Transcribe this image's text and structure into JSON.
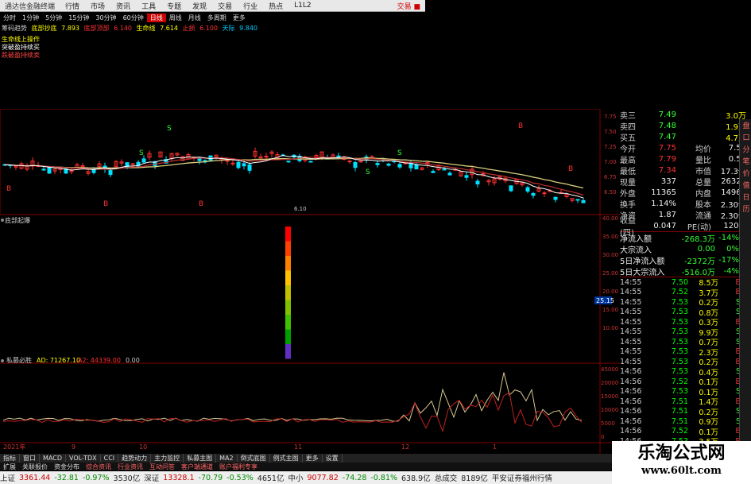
{
  "topbar": {
    "app": "通达信金融终端",
    "menus": [
      "行情",
      "市场",
      "资讯",
      "工具",
      "专题",
      "发现",
      "交易",
      "行业",
      "热点",
      "L1L2"
    ],
    "right": "交易 ■"
  },
  "periods": [
    "分时",
    "1分钟",
    "5分钟",
    "15分钟",
    "30分钟",
    "60分钟",
    "日线",
    "周线",
    "月线",
    "多周期",
    "更多"
  ],
  "indicator_line": {
    "name": "筹码趋势",
    "values": [
      {
        "label": "底部抄底",
        "value": "7.893"
      },
      {
        "label": "底部顶部",
        "value": "6.140"
      },
      {
        "label": "生命线",
        "value": "7.614"
      },
      {
        "label": "止损",
        "value": "6.100"
      },
      {
        "label": "天际",
        "value": "9.840"
      }
    ]
  },
  "signals": [
    {
      "text": "生命线上操作",
      "color": "#ffff00"
    },
    {
      "text": "突破盈持续买",
      "color": "#ffffff"
    },
    {
      "text": "跌破盈持续卖",
      "color": "#ff4040"
    }
  ],
  "main_chart": {
    "yticks": [
      "7.75",
      "7.50",
      "7.25",
      "7.00",
      "6.75",
      "6.50"
    ],
    "low_label": "6.10",
    "x_markers": [
      "11",
      "12",
      "B",
      "S",
      "B"
    ]
  },
  "panel2": {
    "title": "底部起爆",
    "yticks": [
      "40.00",
      "35.00",
      "30.00",
      "25.00",
      "20.00",
      "15.00",
      "10.00"
    ],
    "cursor_value": "25.15"
  },
  "panel3": {
    "title": "私募必胜",
    "ad_label": "AD: 71267.10",
    "a2_label": "A2: 44339.00",
    "a3_label": "0.00",
    "yticks": [
      "45000",
      "20000",
      "15000",
      "10000",
      "5000",
      "0"
    ]
  },
  "x_axis_labels": [
    "2021年",
    "9",
    "10",
    "11",
    "12",
    "1"
  ],
  "quote": {
    "rows": [
      {
        "l": "卖三",
        "p": "7.49",
        "r": "",
        "s": "3.0万"
      },
      {
        "l": "卖四",
        "p": "7.48",
        "r": "",
        "s": "1.9万"
      },
      {
        "l": "买五",
        "p": "7.47",
        "r": "",
        "s": "4.7万"
      },
      {
        "l": "今开",
        "p": "7.75",
        "r": "均价",
        "s": "7.51"
      },
      {
        "l": "最高",
        "p": "7.79",
        "r": "量比",
        "s": "0.57"
      },
      {
        "l": "最低",
        "p": "7.34",
        "r": "市值",
        "s": "17.3亿"
      },
      {
        "l": "现量",
        "p": "337",
        "r": "总量",
        "s": "26328"
      },
      {
        "l": "外盘",
        "p": "11365",
        "r": "内盘",
        "s": "14963"
      },
      {
        "l": "换手",
        "p": "1.14%",
        "r": "股本",
        "s": "2.30亿"
      },
      {
        "l": "净资",
        "p": "1.87",
        "r": "流通",
        "s": "2.30亿"
      },
      {
        "l": "收益(四)",
        "p": "0.047",
        "r": "PE(动)",
        "s": "120.1"
      }
    ],
    "flows": [
      {
        "l": "净流入额",
        "v": "-268.3万",
        "pct": "-14%"
      },
      {
        "l": "大宗流入",
        "v": "0.00",
        "pct": "0%"
      },
      {
        "l": "5日净流入额",
        "v": "-2372万",
        "pct": "-17%"
      },
      {
        "l": "5日大宗流入",
        "v": "-516.0万",
        "pct": "-4%"
      }
    ]
  },
  "ticks": [
    {
      "t": "14:55",
      "p": "7.50",
      "v": "8.5万",
      "d": "B"
    },
    {
      "t": "14:55",
      "p": "7.52",
      "v": "3.7万",
      "d": "B"
    },
    {
      "t": "14:55",
      "p": "7.53",
      "v": "0.2万",
      "d": "S"
    },
    {
      "t": "14:55",
      "p": "7.53",
      "v": "0.8万",
      "d": "S"
    },
    {
      "t": "14:55",
      "p": "7.53",
      "v": "0.3万",
      "d": "B"
    },
    {
      "t": "14:55",
      "p": "7.53",
      "v": "9.9万",
      "d": "S"
    },
    {
      "t": "14:55",
      "p": "7.53",
      "v": "0.7万",
      "d": "S"
    },
    {
      "t": "14:55",
      "p": "7.53",
      "v": "2.3万",
      "d": "B"
    },
    {
      "t": "14:55",
      "p": "7.53",
      "v": "0.2万",
      "d": "B"
    },
    {
      "t": "14:56",
      "p": "7.53",
      "v": "0.4万",
      "d": "S"
    },
    {
      "t": "14:56",
      "p": "7.52",
      "v": "0.1万",
      "d": "B"
    },
    {
      "t": "14:56",
      "p": "7.53",
      "v": "0.1万",
      "d": "S"
    },
    {
      "t": "14:56",
      "p": "7.51",
      "v": "1.4万",
      "d": "B"
    },
    {
      "t": "14:56",
      "p": "7.51",
      "v": "0.2万",
      "d": "S"
    },
    {
      "t": "14:56",
      "p": "7.51",
      "v": "0.9万",
      "d": "S"
    },
    {
      "t": "14:56",
      "p": "7.52",
      "v": "0.1万",
      "d": "B"
    },
    {
      "t": "14:56",
      "p": "7.53",
      "v": "3.5万",
      "d": "B"
    },
    {
      "t": "14:56",
      "p": "7.51",
      "v": "0.1万",
      "d": "B"
    },
    {
      "t": "14:56",
      "p": "7.53",
      "v": "0.2万",
      "d": "S"
    }
  ],
  "sidetabs": [
    "盘",
    "口",
    "分",
    "笔",
    "价",
    "值",
    "日",
    "历"
  ],
  "bottomtabs": [
    "指标",
    "窗口",
    "MACD",
    "VOL-TDX",
    "CCI",
    "趋势动力",
    "主力监控",
    "私募主图",
    "MA2",
    "倒式底图",
    "例式主图",
    "更多",
    "设置"
  ],
  "bottomtabs2": [
    "扩展",
    "关联报价",
    "资金分布",
    "综合资讯",
    "行业资讯",
    "互动问答",
    "客户端通道",
    "账户福利专享"
  ],
  "statusbar": [
    {
      "t": "上证",
      "c": "#222"
    },
    {
      "t": "3361.44",
      "c": "#c00"
    },
    {
      "t": "-32.81",
      "c": "#080"
    },
    {
      "t": "-0.97%",
      "c": "#080"
    },
    {
      "t": "3530亿",
      "c": "#222"
    },
    {
      "t": "深证",
      "c": "#222"
    },
    {
      "t": "13328.1",
      "c": "#c00"
    },
    {
      "t": "-70.79",
      "c": "#080"
    },
    {
      "t": "-0.53%",
      "c": "#080"
    },
    {
      "t": "4651亿",
      "c": "#222"
    },
    {
      "t": "中小",
      "c": "#222"
    },
    {
      "t": "9077.82",
      "c": "#c00"
    },
    {
      "t": "-74.28",
      "c": "#080"
    },
    {
      "t": "-0.81%",
      "c": "#080"
    },
    {
      "t": "638.9亿",
      "c": "#222"
    },
    {
      "t": "总成交",
      "c": "#222"
    },
    {
      "t": "8189亿",
      "c": "#222"
    },
    {
      "t": "平安证券福州行情",
      "c": "#222"
    }
  ],
  "watermark": {
    "line1": "乐淘公式网",
    "line2": "www.60lt.com"
  },
  "colors": {
    "up": "#ff3030",
    "down": "#00ffff",
    "border": "#800000",
    "ma_yellow": "#d8d080",
    "ma_white": "#ffffff"
  }
}
